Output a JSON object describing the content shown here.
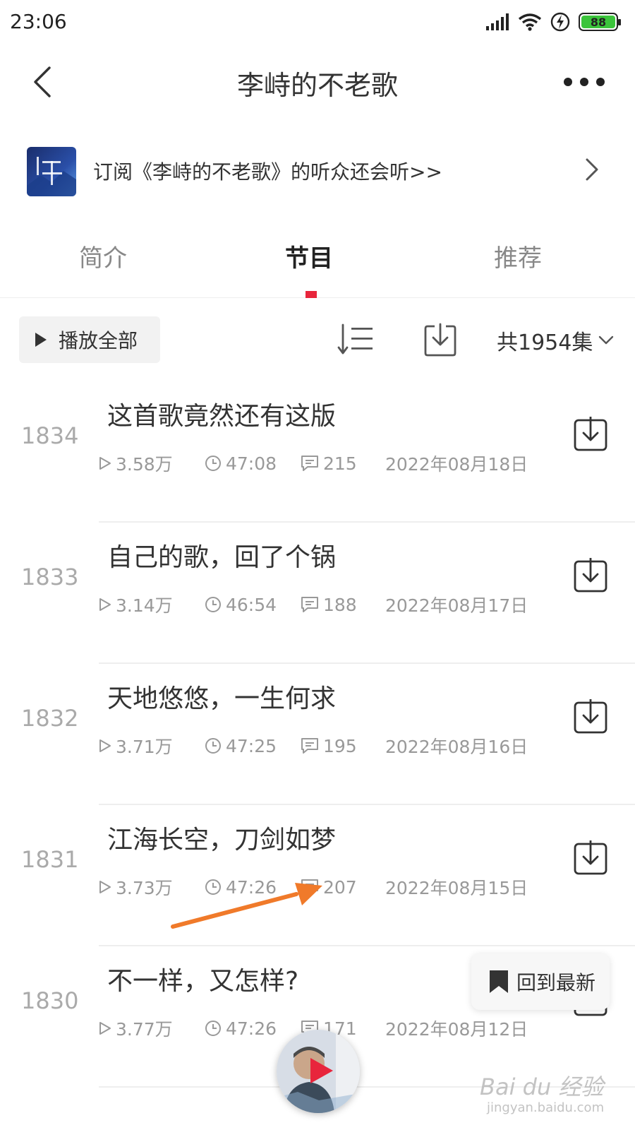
{
  "status_bar": {
    "time": "23:06",
    "battery": "88"
  },
  "header": {
    "title": "李峙的不老歌"
  },
  "banner": {
    "text": "订阅《李峙的不老歌》的听众还会听>>",
    "cover_icon": "album-cover-image"
  },
  "tabs": [
    {
      "label": "简介",
      "active": false
    },
    {
      "label": "节目",
      "active": true
    },
    {
      "label": "推荐",
      "active": false
    }
  ],
  "toolbar": {
    "play_all": "播放全部",
    "count": "共1954集"
  },
  "episodes": [
    {
      "num": "1834",
      "title": "这首歌竟然还有这版",
      "plays": "3.58万",
      "duration": "47:08",
      "comments": "215",
      "date": "2022年08月18日"
    },
    {
      "num": "1833",
      "title": "自己的歌，回了个锅",
      "plays": "3.14万",
      "duration": "46:54",
      "comments": "188",
      "date": "2022年08月17日"
    },
    {
      "num": "1832",
      "title": "天地悠悠，一生何求",
      "plays": "3.71万",
      "duration": "47:25",
      "comments": "195",
      "date": "2022年08月16日"
    },
    {
      "num": "1831",
      "title": "江海长空，刀剑如梦",
      "plays": "3.73万",
      "duration": "47:26",
      "comments": "207",
      "date": "2022年08月15日"
    },
    {
      "num": "1830",
      "title": "不一样，又怎样?",
      "plays": "3.77万",
      "duration": "47:26",
      "comments": "171",
      "date": "2022年08月12日"
    }
  ],
  "floating": {
    "back_to_latest": "回到最新"
  },
  "colors": {
    "accent": "#e8253c",
    "arrow": "#f07a2a"
  },
  "watermark": {
    "brand": "Bai du 经验",
    "url": "jingyan.baidu.com"
  }
}
